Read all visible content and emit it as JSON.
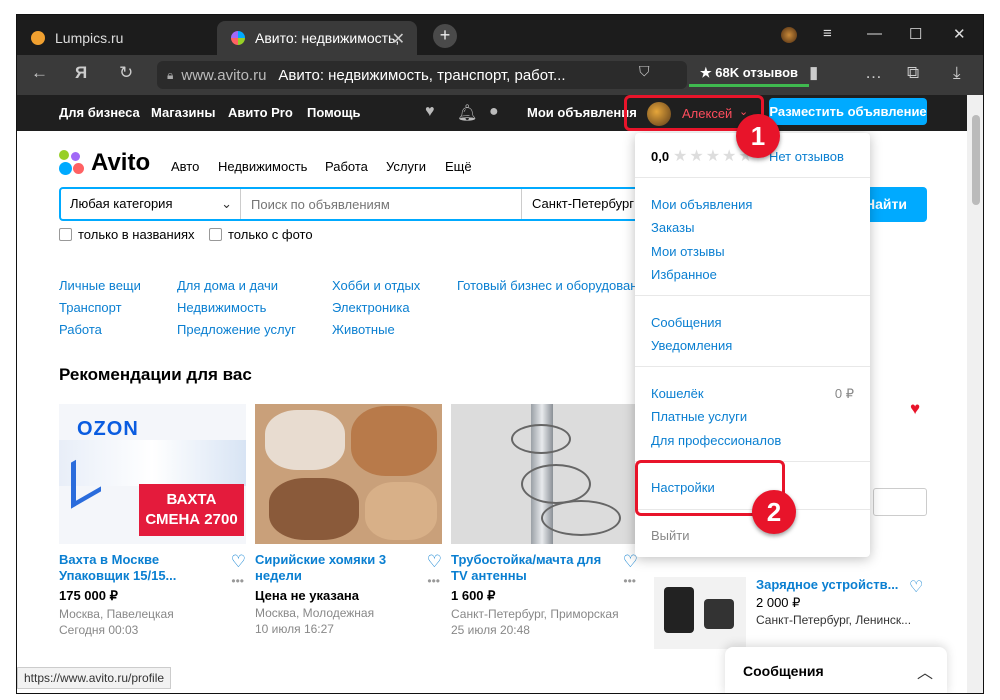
{
  "browser": {
    "tabs": [
      {
        "label": "Lumpics.ru"
      },
      {
        "label": "Авито: недвижимость, "
      }
    ],
    "url_host": "www.avito.ru",
    "page_title": "Авито: недвижимость, транспорт, работ...",
    "reviews_badge": "★ 68K отзывов",
    "status_url": "https://www.avito.ru/profile"
  },
  "avito_header": {
    "links": [
      "Для бизнеса",
      "Магазины",
      "Авито Pro",
      "Помощь"
    ],
    "my_ads": "Мои объявления",
    "user_name": "Алексей",
    "post_button": "Разместить объявление"
  },
  "main": {
    "logo_text": "Avito",
    "nav": [
      "Авто",
      "Недвижимость",
      "Работа",
      "Услуги",
      "Ещё"
    ],
    "search": {
      "category": "Любая категория",
      "placeholder": "Поиск по объявлениям",
      "city": "Санкт-Петербург",
      "find_button": "Найти"
    },
    "checkboxes": [
      "только в названиях",
      "только с фото"
    ],
    "categories": [
      [
        "Личные вещи",
        "Транспорт",
        "Работа"
      ],
      [
        "Для дома и дачи",
        "Недвижимость",
        "Предложение услуг"
      ],
      [
        "Хобби и отдых",
        "Электроника",
        "Животные"
      ],
      [
        "Готовый бизнес и оборудование"
      ]
    ],
    "recommendations_title": "Рекомендации для вас",
    "cards": [
      {
        "title": "Вахта в Москве Упаковщик 15/15...",
        "price": "175 000 ₽",
        "location": "Москва, Павелецкая",
        "date": "Сегодня 00:03",
        "banner": "ВАХТА СМЕНА 2700",
        "brand": "OZON"
      },
      {
        "title": "Сирийские хомяки 3 недели",
        "price": "Цена не указана",
        "location": "Москва, Молодежная",
        "date": "10 июля 16:27"
      },
      {
        "title": "Трубостойка/мачта для TV антенны",
        "price": "1 600 ₽",
        "location": "Санкт-Петербург, Приморская",
        "date": "25 июля 20:48"
      }
    ],
    "right_card": {
      "title": "Зарядное устройств...",
      "price": "2 000 ₽",
      "location": "Санкт-Петербург, Ленинск..."
    },
    "messages_bar": "Сообщения"
  },
  "dropdown": {
    "rating": "0,0",
    "no_reviews": "Нет отзывов",
    "group1": [
      "Мои объявления",
      "Заказы",
      "Мои отзывы",
      "Избранное"
    ],
    "group2": [
      "Сообщения",
      "Уведомления"
    ],
    "group3": [
      "Кошелёк",
      "Платные услуги",
      "Для профессионалов"
    ],
    "wallet_balance": "0 ₽",
    "settings": "Настройки",
    "logout": "Выйти"
  },
  "annotations": [
    "1",
    "2"
  ],
  "colors": {
    "accent": "#00aaff",
    "highlight": "#e8142a",
    "link": "#0a7fd1"
  }
}
